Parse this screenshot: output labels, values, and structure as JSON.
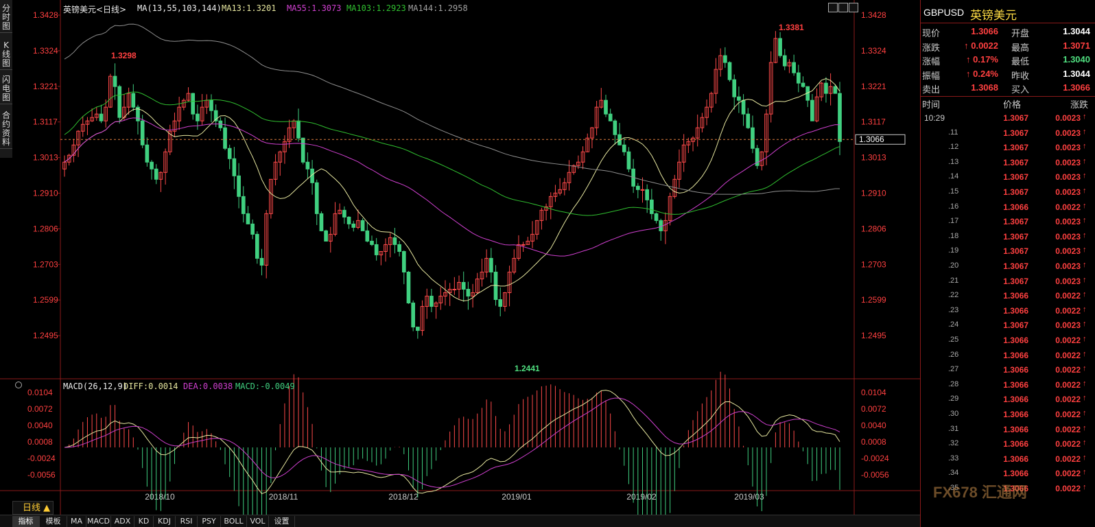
{
  "left_tabs": [
    "分时图",
    "K线图",
    "闪电图",
    "合约资料"
  ],
  "header": {
    "title": "英镑美元<日线>",
    "ma_label": "MA(13,55,103,144)",
    "ma13": "MA13:1.3201",
    "ma55": "MA55:1.3073",
    "ma103": "MA103:1.2923",
    "ma144": "MA144:1.2958"
  },
  "macd_header": {
    "label": "MACD(26,12,9)",
    "diff": "DIFF:0.0014",
    "dea": "DEA:0.0038",
    "macd": "MACD:-0.0049"
  },
  "price_axis_left": [
    "1.3428",
    "1.3324",
    "1.3221",
    "1.3117",
    "1.3013",
    "1.2910",
    "1.2806",
    "1.2703",
    "1.2599",
    "1.2495"
  ],
  "price_axis_right": [
    "1.3428",
    "1.3324",
    "1.3221",
    "1.3117",
    "1.3013",
    "1.2910",
    "1.2806",
    "1.2703",
    "1.2599",
    "1.2495"
  ],
  "macd_axis": [
    "0.0104",
    "0.0072",
    "0.0040",
    "0.0008",
    "-0.0024",
    "-0.0056"
  ],
  "date_labels": [
    "2018/10",
    "2018/11",
    "2018/12",
    "2019/01",
    "2019/02",
    "2019/03"
  ],
  "annotations": {
    "high_left": "1.3298",
    "low": "1.2441",
    "high_right": "1.3381",
    "current": "1.3066"
  },
  "period_label": "日线 ▲",
  "bottom_tabs": [
    "指标",
    "模板",
    "MA",
    "MACD",
    "ADX",
    "KD",
    "KDJ",
    "RSI",
    "PSY",
    "BOLL",
    "VOL",
    "设置"
  ],
  "panel": {
    "symbol": "GBPUSD",
    "name": "英镑美元",
    "quotes": [
      {
        "l1": "现价",
        "v1": "1.3066",
        "c1": "#ff4040",
        "l2": "开盘",
        "v2": "1.3044",
        "c2": "#ffffff"
      },
      {
        "l1": "涨跌",
        "v1": "↑ 0.0022",
        "c1": "#ff4040",
        "l2": "最高",
        "v2": "1.3071",
        "c2": "#ff4040"
      },
      {
        "l1": "涨幅",
        "v1": "↑ 0.17%",
        "c1": "#ff4040",
        "l2": "最低",
        "v2": "1.3040",
        "c2": "#50e080"
      },
      {
        "l1": "振幅",
        "v1": "↑ 0.24%",
        "c1": "#ff4040",
        "l2": "昨收",
        "v2": "1.3044",
        "c2": "#ffffff"
      },
      {
        "l1": "卖出",
        "v1": "1.3068",
        "c1": "#ff4040",
        "l2": "买入",
        "v2": "1.3066",
        "c2": "#ff4040"
      }
    ],
    "tick_headers": [
      "时间",
      "价格",
      "涨跌"
    ],
    "ticks": [
      {
        "t": "10:29",
        "p": "1.3067",
        "c": "0.0023"
      },
      {
        "t": ".11",
        "p": "1.3067",
        "c": "0.0023"
      },
      {
        "t": ".12",
        "p": "1.3067",
        "c": "0.0023"
      },
      {
        "t": ".13",
        "p": "1.3067",
        "c": "0.0023"
      },
      {
        "t": ".14",
        "p": "1.3067",
        "c": "0.0023"
      },
      {
        "t": ".15",
        "p": "1.3067",
        "c": "0.0023"
      },
      {
        "t": ".16",
        "p": "1.3066",
        "c": "0.0022"
      },
      {
        "t": ".17",
        "p": "1.3067",
        "c": "0.0023"
      },
      {
        "t": ".18",
        "p": "1.3067",
        "c": "0.0023"
      },
      {
        "t": ".19",
        "p": "1.3067",
        "c": "0.0023"
      },
      {
        "t": ".20",
        "p": "1.3067",
        "c": "0.0023"
      },
      {
        "t": ".21",
        "p": "1.3067",
        "c": "0.0023"
      },
      {
        "t": ".22",
        "p": "1.3066",
        "c": "0.0022"
      },
      {
        "t": ".23",
        "p": "1.3066",
        "c": "0.0022"
      },
      {
        "t": ".24",
        "p": "1.3067",
        "c": "0.0023"
      },
      {
        "t": ".25",
        "p": "1.3066",
        "c": "0.0022"
      },
      {
        "t": ".26",
        "p": "1.3066",
        "c": "0.0022"
      },
      {
        "t": ".27",
        "p": "1.3066",
        "c": "0.0022"
      },
      {
        "t": ".28",
        "p": "1.3066",
        "c": "0.0022"
      },
      {
        "t": ".29",
        "p": "1.3066",
        "c": "0.0022"
      },
      {
        "t": ".30",
        "p": "1.3066",
        "c": "0.0022"
      },
      {
        "t": ".31",
        "p": "1.3066",
        "c": "0.0022"
      },
      {
        "t": ".32",
        "p": "1.3066",
        "c": "0.0022"
      },
      {
        "t": ".33",
        "p": "1.3066",
        "c": "0.0022"
      },
      {
        "t": ".34",
        "p": "1.3066",
        "c": "0.0022"
      },
      {
        "t": ".35",
        "p": "1.3066",
        "c": "0.0022"
      }
    ]
  },
  "watermark": "FX678 汇通网",
  "colors": {
    "up": "#ff4a4a",
    "down": "#40d080",
    "ma13": "#e8e8a0",
    "ma55": "#d040d0",
    "ma103": "#30c030",
    "ma144": "#909090",
    "axis_text": "#ff4040",
    "grid": "#8b1a1a"
  },
  "chart_data": {
    "type": "candlestick",
    "ylim": [
      1.2441,
      1.3428
    ],
    "candles_close": [
      1.3,
      1.302,
      1.305,
      1.309,
      1.311,
      1.312,
      1.313,
      1.314,
      1.312,
      1.316,
      1.325,
      1.322,
      1.313,
      1.316,
      1.32,
      1.316,
      1.312,
      1.305,
      1.3,
      1.298,
      1.295,
      1.297,
      1.303,
      1.309,
      1.312,
      1.316,
      1.318,
      1.32,
      1.314,
      1.312,
      1.316,
      1.318,
      1.315,
      1.312,
      1.31,
      1.304,
      1.301,
      1.296,
      1.29,
      1.285,
      1.282,
      1.279,
      1.272,
      1.27,
      1.285,
      1.295,
      1.3,
      1.303,
      1.306,
      1.31,
      1.312,
      1.307,
      1.3,
      1.298,
      1.294,
      1.285,
      1.28,
      1.277,
      1.279,
      1.285,
      1.286,
      1.284,
      1.282,
      1.281,
      1.283,
      1.28,
      1.277,
      1.276,
      1.273,
      1.274,
      1.276,
      1.278,
      1.276,
      1.274,
      1.268,
      1.259,
      1.252,
      1.251,
      1.258,
      1.261,
      1.258,
      1.259,
      1.261,
      1.262,
      1.263,
      1.263,
      1.265,
      1.263,
      1.261,
      1.262,
      1.266,
      1.268,
      1.272,
      1.268,
      1.26,
      1.258,
      1.262,
      1.268,
      1.272,
      1.276,
      1.276,
      1.277,
      1.279,
      1.283,
      1.286,
      1.287,
      1.29,
      1.291,
      1.292,
      1.294,
      1.297,
      1.299,
      1.3,
      1.303,
      1.307,
      1.31,
      1.316,
      1.318,
      1.314,
      1.312,
      1.308,
      1.305,
      1.303,
      1.298,
      1.293,
      1.292,
      1.292,
      1.289,
      1.285,
      1.283,
      1.28,
      1.283,
      1.29,
      1.295,
      1.3,
      1.305,
      1.306,
      1.307,
      1.31,
      1.313,
      1.316,
      1.32,
      1.327,
      1.331,
      1.329,
      1.324,
      1.319,
      1.318,
      1.314,
      1.31,
      1.304,
      1.299,
      1.303,
      1.314,
      1.329,
      1.336,
      1.331,
      1.328,
      1.329,
      1.326,
      1.323,
      1.322,
      1.318,
      1.312,
      1.319,
      1.323,
      1.32,
      1.322,
      1.32,
      1.306
    ]
  }
}
